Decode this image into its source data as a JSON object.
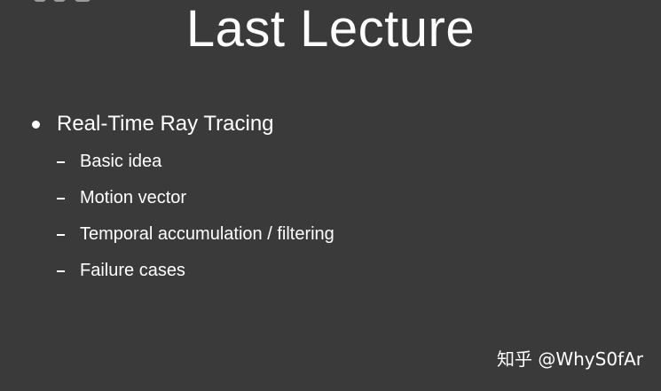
{
  "slide": {
    "title": "Last Lecture",
    "bullets": [
      {
        "text": "Real-Time Ray Tracing",
        "subitems": [
          "Basic idea",
          "Motion vector",
          "Temporal accumulation / filtering",
          "Failure cases"
        ]
      }
    ]
  },
  "watermark": {
    "text": "知乎 @WhyS0fAr"
  },
  "colors": {
    "background": "#3a3a3a",
    "text": "#ffffff"
  }
}
